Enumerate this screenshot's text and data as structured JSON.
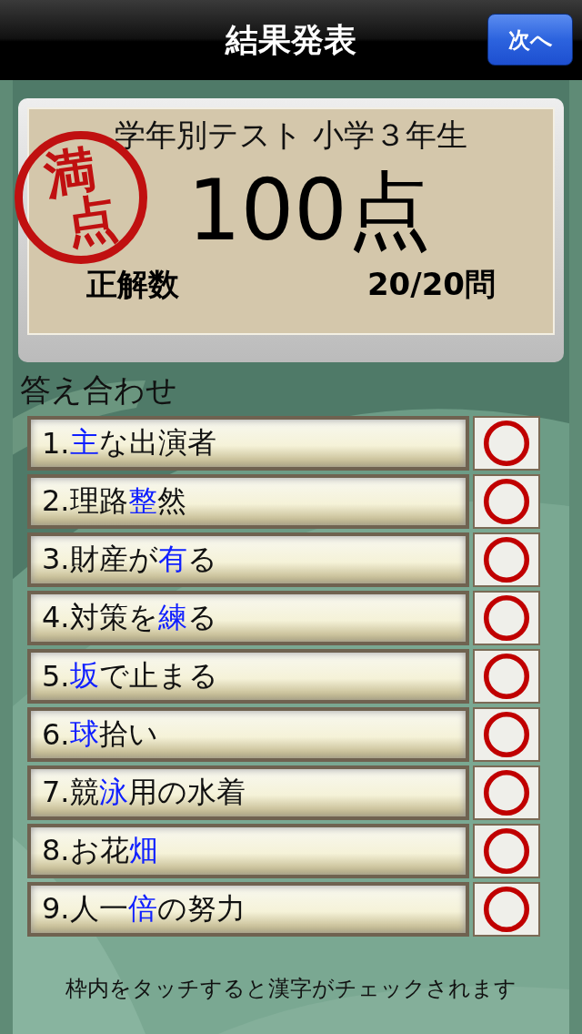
{
  "nav": {
    "title": "結果発表",
    "next_button": "次へ"
  },
  "score": {
    "test_name": "学年別テスト 小学３年生",
    "stamp": [
      "満",
      "点"
    ],
    "points": "100点",
    "correct_label": "正解数",
    "correct_count": "20/20問"
  },
  "answers": {
    "heading": "答え合わせ",
    "items": [
      {
        "number": "1.",
        "key": "主",
        "after": "な出演者",
        "correct": true
      },
      {
        "number": "2.",
        "before": "理路",
        "key": "整",
        "after": "然",
        "correct": true
      },
      {
        "number": "3.",
        "before": "財産が",
        "key": "有",
        "after": "る",
        "correct": true
      },
      {
        "number": "4.",
        "before": "対策を",
        "key": "練",
        "after": "る",
        "correct": true
      },
      {
        "number": "5.",
        "key": "坂",
        "after": "で止まる",
        "correct": true
      },
      {
        "number": "6.",
        "key": "球",
        "after": "拾い",
        "correct": true
      },
      {
        "number": "7.",
        "before": "競",
        "key": "泳",
        "after": "用の水着",
        "correct": true
      },
      {
        "number": "8.",
        "before": "お花",
        "key": "畑",
        "correct": true
      },
      {
        "number": "9.",
        "before": "人一",
        "key": "倍",
        "after": "の努力",
        "correct": true
      }
    ]
  },
  "footer": "枠内をタッチすると漢字がチェックされます"
}
